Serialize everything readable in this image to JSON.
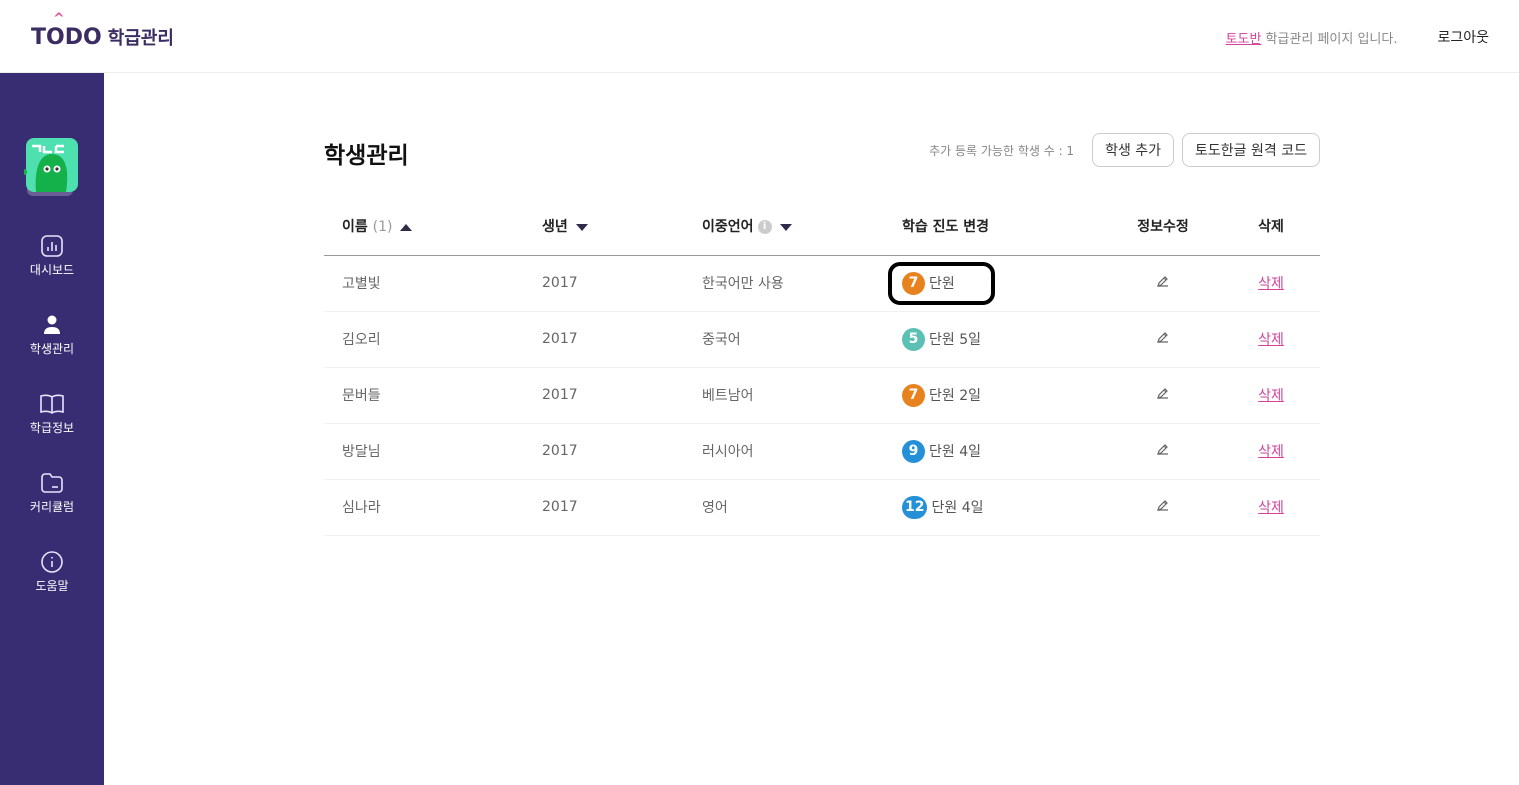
{
  "header": {
    "logo_text": "TODO",
    "logo_sub": "학급관리",
    "class_name": "토도반",
    "message": "학급관리 페이지 입니다.",
    "logout": "로그아웃"
  },
  "sidebar": {
    "items": [
      {
        "label": "대시보드",
        "icon": "chart-icon"
      },
      {
        "label": "학생관리",
        "icon": "person-icon"
      },
      {
        "label": "학급정보",
        "icon": "book-icon"
      },
      {
        "label": "커리큘럼",
        "icon": "folder-icon"
      },
      {
        "label": "도움말",
        "icon": "info-icon"
      }
    ]
  },
  "main": {
    "title": "학생관리",
    "available": "추가 등록 가능한 학생 수 : 1",
    "add_student": "학생 추가",
    "remote_code": "토도한글 원격 코드",
    "columns": {
      "name": "이름",
      "name_count": "(1)",
      "birth": "생년",
      "language": "이중언어",
      "progress": "학습 진도 변경",
      "edit": "정보수정",
      "delete": "삭제"
    },
    "rows": [
      {
        "name": "고별빛",
        "birth": "2017",
        "language": "한국어만 사용",
        "unit": "7",
        "unit_color": "#e8821f",
        "progress": "단원",
        "delete": "삭제"
      },
      {
        "name": "김오리",
        "birth": "2017",
        "language": "중국어",
        "unit": "5",
        "unit_color": "#5cc0b4",
        "progress": "단원 5일",
        "delete": "삭제"
      },
      {
        "name": "문버들",
        "birth": "2017",
        "language": "베트남어",
        "unit": "7",
        "unit_color": "#e8821f",
        "progress": "단원 2일",
        "delete": "삭제"
      },
      {
        "name": "방달님",
        "birth": "2017",
        "language": "러시아어",
        "unit": "9",
        "unit_color": "#2490d8",
        "progress": "단원 4일",
        "delete": "삭제"
      },
      {
        "name": "심나라",
        "birth": "2017",
        "language": "영어",
        "unit": "12",
        "unit_color": "#2490d8",
        "progress": "단원 4일",
        "delete": "삭제"
      }
    ]
  }
}
